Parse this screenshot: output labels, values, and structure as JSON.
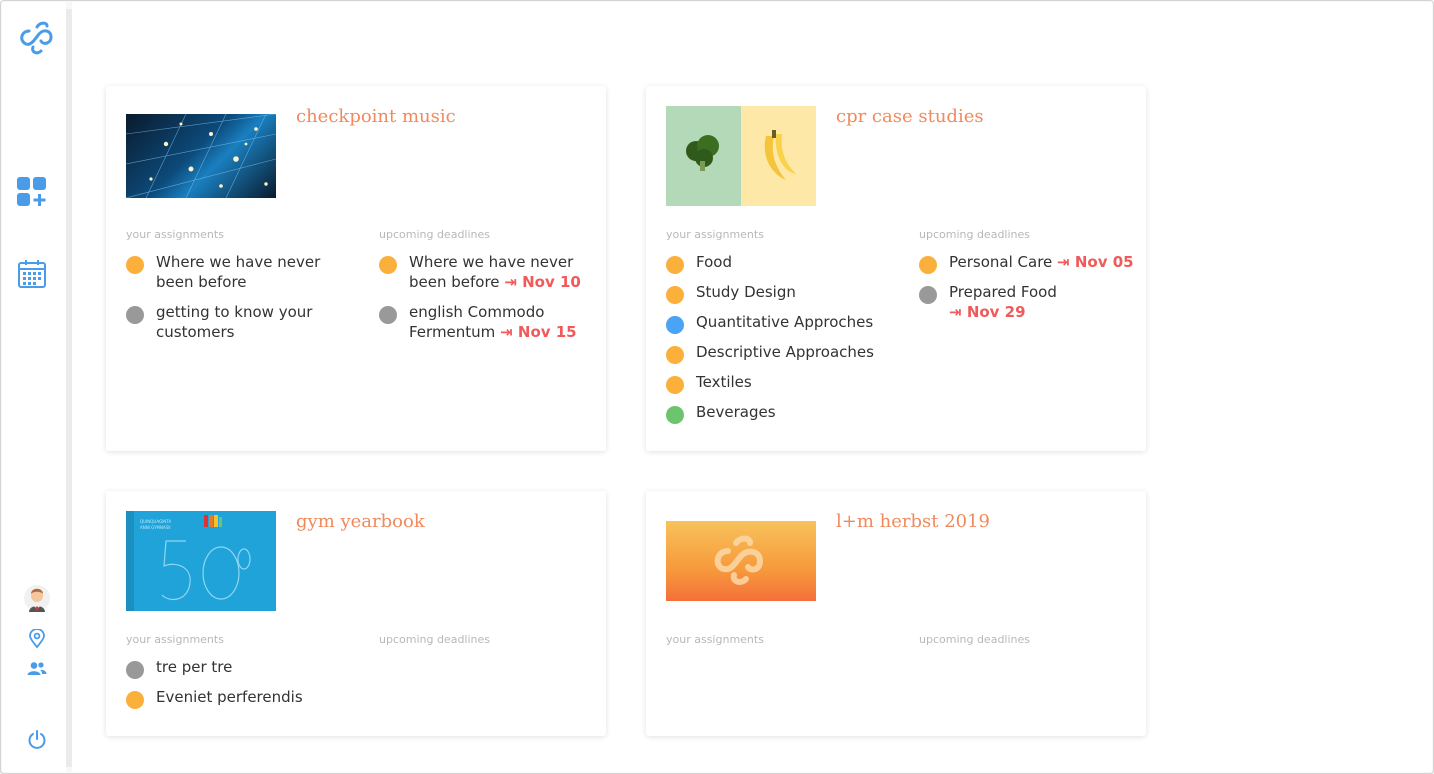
{
  "colors": {
    "accent_blue": "#4a9ce8",
    "title_orange": "#f08a5d",
    "deadline_red": "#f05a5a",
    "dot_orange": "#fbb03b",
    "dot_gray": "#999999",
    "dot_blue": "#4aa3f5",
    "dot_green": "#6cc56c"
  },
  "sidebar": {
    "icons": [
      "logo-icon",
      "add-board-icon",
      "calendar-icon",
      "avatar",
      "location-icon",
      "people-icon",
      "power-icon"
    ]
  },
  "labels": {
    "assignments": "your assignments",
    "deadlines": "upcoming deadlines",
    "deadline_arrow": "⇥"
  },
  "cards": [
    {
      "title": "checkpoint music",
      "assignments": [
        {
          "text": "Where we have never been before",
          "status": "orange"
        },
        {
          "text": "getting to know your customers",
          "status": "gray"
        }
      ],
      "deadlines": [
        {
          "text": "Where we have never been before",
          "date": "Nov 10",
          "status": "orange"
        },
        {
          "text": "english Commodo Fermentum",
          "date": "Nov 15",
          "status": "gray"
        }
      ]
    },
    {
      "title": "cpr case studies",
      "assignments": [
        {
          "text": "Food",
          "status": "orange"
        },
        {
          "text": "Study Design",
          "status": "orange"
        },
        {
          "text": "Quantitative Approches",
          "status": "blue"
        },
        {
          "text": "Descriptive Approaches",
          "status": "orange"
        },
        {
          "text": "Textiles",
          "status": "orange"
        },
        {
          "text": "Beverages",
          "status": "green"
        }
      ],
      "deadlines": [
        {
          "text": "Personal Care",
          "date": "Nov 05",
          "status": "orange"
        },
        {
          "text": "Prepared Food",
          "date": "Nov 29",
          "status": "gray"
        }
      ]
    },
    {
      "title": "gym yearbook",
      "thumb_text": "50",
      "assignments": [
        {
          "text": "tre per tre",
          "status": "gray"
        },
        {
          "text": "Eveniet perferendis",
          "status": "orange"
        }
      ],
      "deadlines": []
    },
    {
      "title": "l+m herbst 2019",
      "assignments": [],
      "deadlines": []
    }
  ]
}
